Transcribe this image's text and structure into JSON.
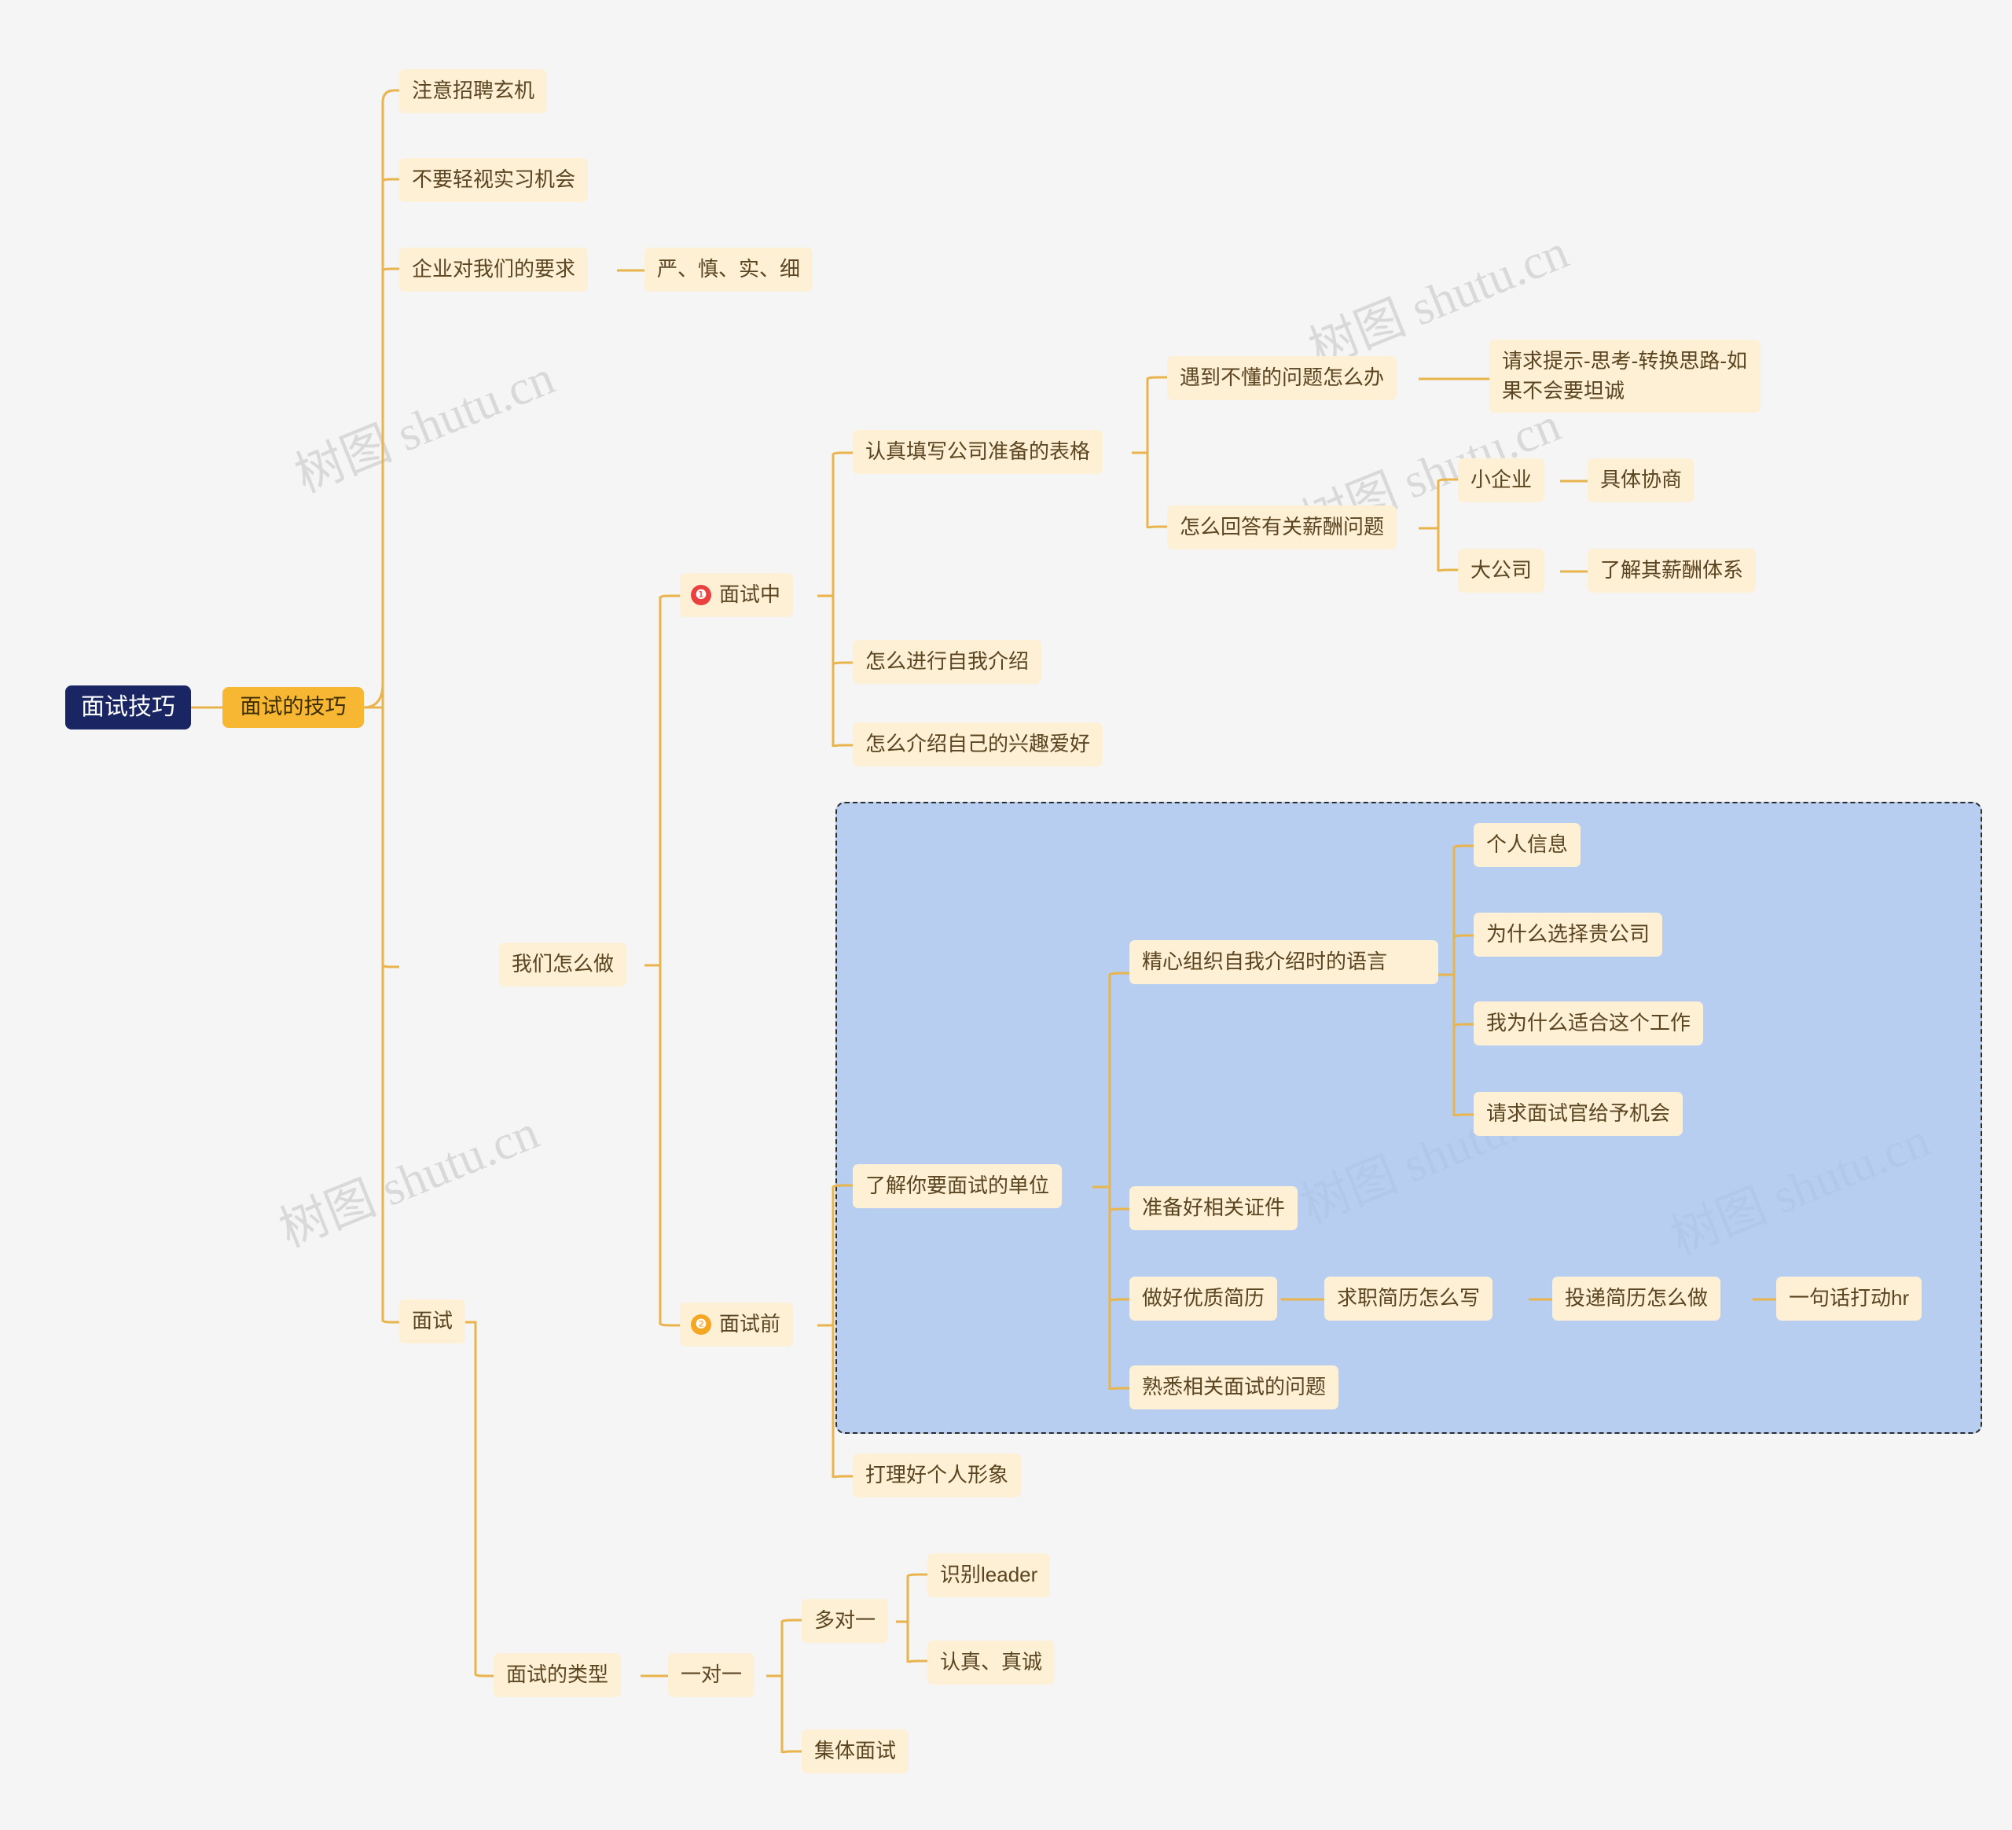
{
  "diagram": {
    "type": "mindmap",
    "title": "面试技巧",
    "root": {
      "label": "面试技巧"
    },
    "main": {
      "label": "面试的技巧"
    },
    "nodes": {
      "zhuyi": "注意招聘玄机",
      "shixi": "不要轻视实习机会",
      "qiye": "企业对我们的要求",
      "yanshen": "严、慎、实、细",
      "women": "我们怎么做",
      "mianshi": "面试",
      "mianshizhong": "面试中",
      "mianshiqian": "面试前",
      "biaoge": "认真填写公司准备的表格",
      "budong": "遇到不懂的问题怎么办",
      "qingqiu": "请求提示-思考-转换思路-如果不会要坦诚",
      "xinchou": "怎么回答有关薪酬问题",
      "xiaoqiye": "小企业",
      "juti": "具体协商",
      "dagongsi": "大公司",
      "liaojie_xc": "了解其薪酬体系",
      "ziwojieshao": "怎么进行自我介绍",
      "xingqu": "怎么介绍自己的兴趣爱好",
      "liaojie_danwei": "了解你要面试的单位",
      "jingxin": "精心组织自我介绍时的语言",
      "gerenxinxi": "个人信息",
      "weishenme": "为什么选择贵公司",
      "shihe": "我为什么适合这个工作",
      "jihui": "请求面试官给予机会",
      "zhengjian": "准备好相关证件",
      "jianli": "做好优质简历",
      "qiuzhi": "求职简历怎么写",
      "toudi": "投递简历怎么做",
      "yijuhua": "一句话打动hr",
      "shuxi": "熟悉相关面试的问题",
      "dali": "打理好个人形象",
      "leixing": "面试的类型",
      "yiduiyi": "一对一",
      "duoduiyi": "多对一",
      "leader": "识别leader",
      "renzhen": "认真、真诚",
      "jiti": "集体面试"
    },
    "badges": {
      "one": "❶",
      "two": "❷"
    },
    "colors": {
      "root_bg": "#1a2563",
      "root_text": "#ffffff",
      "main_bg": "#f7b733",
      "leaf_bg": "#fdf0d5",
      "leaf_text": "#5b4420",
      "link": "#e9b44c",
      "selection_fill": "#a7c3f0",
      "selection_border": "#2b2b2b",
      "canvas_bg": "#f5f5f5"
    },
    "watermarks": [
      "树图 shutu.cn",
      "树图 shutu.cn",
      "树图 shutu.cn",
      "树图 shutu.cn",
      "树图 shutu.cn",
      "树图 shutu.cn"
    ]
  }
}
